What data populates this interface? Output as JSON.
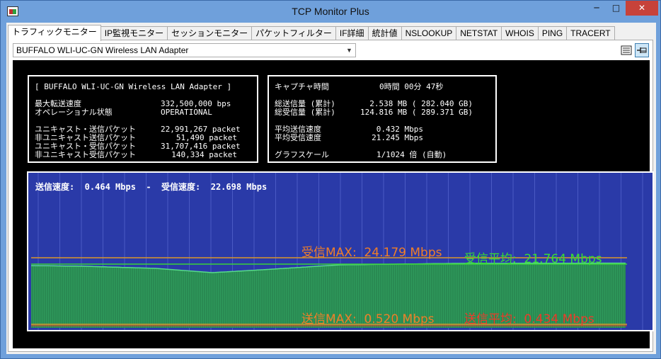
{
  "window": {
    "title": "TCP Monitor Plus",
    "controls": {
      "minimize": "─",
      "maximize": "□",
      "close": "✕"
    }
  },
  "tabs": [
    {
      "label": "トラフィックモニター",
      "active": true
    },
    {
      "label": "IP監視モニター"
    },
    {
      "label": "セッションモニター"
    },
    {
      "label": "パケットフィルター"
    },
    {
      "label": "IF詳細"
    },
    {
      "label": "統計値"
    },
    {
      "label": "NSLOOKUP"
    },
    {
      "label": "NETSTAT"
    },
    {
      "label": "WHOIS"
    },
    {
      "label": "PING"
    },
    {
      "label": "TRACERT"
    }
  ],
  "adapter": {
    "selected": "BUFFALO WLI-UC-GN Wireless LAN Adapter"
  },
  "toolbar": {
    "list_icon": "list-icon",
    "pin_icon": "pin-icon"
  },
  "adapter_info": {
    "header": "[ BUFFALO WLI-UC-GN Wireless LAN Adapter ]",
    "rows": [
      {
        "label": "最大転送速度",
        "value": "332,500,000 bps"
      },
      {
        "label": "オペレーショナル状態",
        "value": "OPERATIONAL"
      },
      {
        "label": "ユニキャスト・送信パケット",
        "value": "22,991,267 packet"
      },
      {
        "label": "非ユニキャスト送信パケット",
        "value": "51,490 packet"
      },
      {
        "label": "ユニキャスト・受信パケット",
        "value": "31,707,416 packet"
      },
      {
        "label": "非ユニキャスト受信パケット",
        "value": "140,334 packet"
      }
    ]
  },
  "capture_info": {
    "rows": [
      {
        "label": "キャプチャ時間",
        "value": "0時間 00分 47秒"
      },
      {
        "label": "総送信量 (累計)",
        "value": "2.538 MB ( 282.040 GB)"
      },
      {
        "label": "総受信量 (累計)",
        "value": "124.816 MB ( 289.371 GB)"
      },
      {
        "label": "平均送信速度",
        "value": "0.432 Mbps"
      },
      {
        "label": "平均受信速度",
        "value": "21.245 Mbps"
      },
      {
        "label": "グラフスケール",
        "value": "1/1024 倍 (自動)"
      }
    ]
  },
  "graph": {
    "speed_line": "送信速度:  0.464 Mbps  -  受信速度:  22.698 Mbps",
    "recv_max": "受信MAX:  24.179 Mbps",
    "recv_avg": "受信平均:  21.764 Mbps",
    "send_max": "送信MAX:  0.520 Mbps",
    "send_avg": "送信平均:  0.434 Mbps",
    "colors": {
      "background": "#2a3aa8",
      "recv_fill": "#2f9a5c",
      "recv_top": "#57d98a",
      "max_line": "#d9962a",
      "avg_line": "#38d138",
      "recv_max_text": "#f07e28",
      "recv_avg_text": "#38e030",
      "send_max_text": "#f07e28",
      "send_avg_text": "#f03a2a",
      "grid": "#4a5ac4"
    }
  }
}
